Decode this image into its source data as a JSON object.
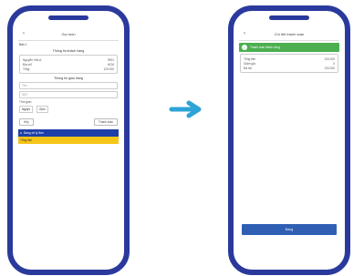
{
  "left_screen": {
    "title": "Gọi món",
    "back_icon": "chevron-left-icon",
    "tag": "Bàn 1",
    "section1_title": "Thông tin khách hàng",
    "section1_rows": [
      {
        "k": "Nguyễn Văn A",
        "v": "0901"
      },
      {
        "k": "Địa chỉ",
        "v": "HCM"
      },
      {
        "k": "Tổng",
        "v": "120.000"
      }
    ],
    "section2_title": "Thông tin giao hàng",
    "input1_placeholder": "Tên",
    "input2_placeholder": "SĐT",
    "small_label": "Thời gian",
    "select1": "Ngày",
    "select2": "Giờ",
    "btn_left": "Hủy",
    "btn_right": "Thanh toán",
    "bar_blue_text": "Đang xử lý đơn",
    "bar_yellow_text": "Tổng tiền"
  },
  "right_screen": {
    "title": "Chi tiết thanh toán",
    "back_icon": "chevron-left-icon",
    "banner_text": "Thanh toán thành công",
    "rows": [
      {
        "k": "Tổng tiền",
        "v": "120.000"
      },
      {
        "k": "Giảm giá",
        "v": "0"
      },
      {
        "k": "Đã trả",
        "v": "120.000"
      }
    ],
    "primary_button": "Đóng"
  }
}
